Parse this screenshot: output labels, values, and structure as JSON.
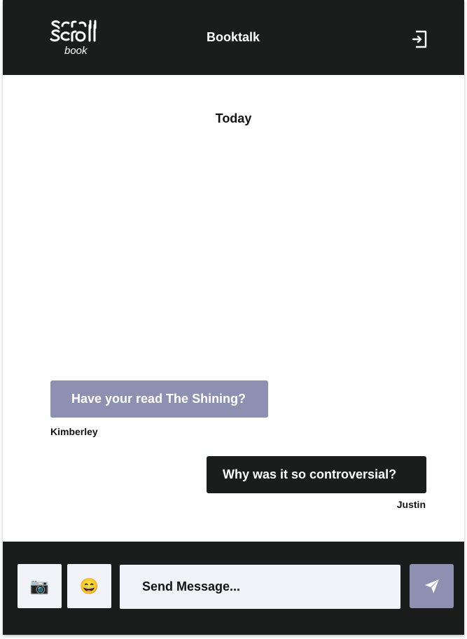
{
  "header": {
    "logo_text": "Scroll Scroll book",
    "title": "Booktalk",
    "logout_icon": "logout-icon"
  },
  "chat": {
    "day_label": "Today",
    "messages": [
      {
        "text": "Have your read The Shining?",
        "sender": "Kimberley",
        "direction": "incoming"
      },
      {
        "text": "Why was it so controversial?",
        "sender": "Justin",
        "direction": "outgoing"
      }
    ]
  },
  "composer": {
    "camera_icon": "📷",
    "emoji_icon": "😄",
    "placeholder": "Send Message...",
    "send_icon": "send-icon"
  },
  "colors": {
    "dark": "#1b1c1c",
    "accent": "#8e90b1",
    "input_bg": "#f2f3f8"
  }
}
